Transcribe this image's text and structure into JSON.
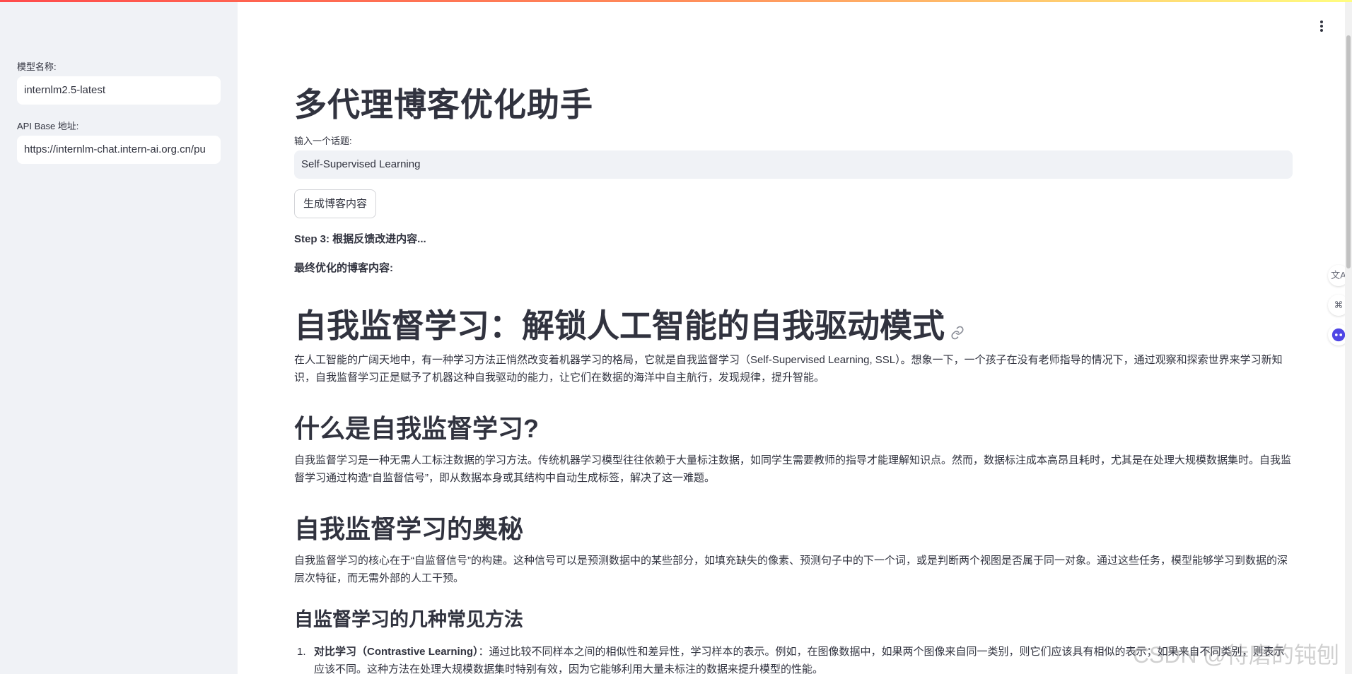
{
  "colors": {
    "accent": "#ff4b4b",
    "sidebar_bg": "#f0f2f6",
    "text": "#31333f"
  },
  "sidebar": {
    "model_label": "模型名称:",
    "model_value": "internlm2.5-latest",
    "api_label": "API Base 地址:",
    "api_value": "https://internlm-chat.intern-ai.org.cn/pu"
  },
  "header": {
    "menu_icon": "more-vertical-icon"
  },
  "main": {
    "title": "多代理博客优化助手",
    "topic_label": "输入一个话题:",
    "topic_value": "Self-Supervised Learning",
    "generate_button": "生成博客内容",
    "step_text": "Step 3: 根据反馈改进内容...",
    "final_label": "最终优化的博客内容:"
  },
  "article": {
    "h1": "自我监督学习：解锁人工智能的自我驱动模式",
    "p1": "在人工智能的广阔天地中，有一种学习方法正悄然改变着机器学习的格局，它就是自我监督学习（Self-Supervised Learning, SSL）。想象一下，一个孩子在没有老师指导的情况下，通过观察和探索世界来学习新知识，自我监督学习正是赋予了机器这种自我驱动的能力，让它们在数据的海洋中自主航行，发现规律，提升智能。",
    "h2_1": "什么是自我监督学习?",
    "p2": "自我监督学习是一种无需人工标注数据的学习方法。传统机器学习模型往往依赖于大量标注数据，如同学生需要教师的指导才能理解知识点。然而，数据标注成本高昂且耗时，尤其是在处理大规模数据集时。自我监督学习通过构造“自监督信号”，即从数据本身或其结构中自动生成标签，解决了这一难题。",
    "h2_2": "自我监督学习的奥秘",
    "p3": "自我监督学习的核心在于“自监督信号”的构建。这种信号可以是预测数据中的某些部分，如填充缺失的像素、预测句子中的下一个词，或是判断两个视图是否属于同一对象。通过这些任务，模型能够学习到数据的深层次特征，而无需外部的人工干预。",
    "h3_1": "自监督学习的几种常见方法",
    "list": [
      {
        "num": "1.",
        "term": "对比学习（Contrastive Learning）",
        "text": "：通过比较不同样本之间的相似性和差异性，学习样本的表示。例如，在图像数据中，如果两个图像来自同一类别，则它们应该具有相似的表示；如果来自不同类别，则表示应该不同。这种方法在处理大规模数据集时特别有效，因为它能够利用大量未标注的数据来提升模型的性能。"
      }
    ]
  },
  "floatbar": {
    "icons": [
      "translate-icon",
      "command-icon",
      "assistant-icon"
    ],
    "translate_glyph": "文A",
    "command_glyph": "⌘"
  },
  "watermark": "CSDN @待磨的钝刨"
}
